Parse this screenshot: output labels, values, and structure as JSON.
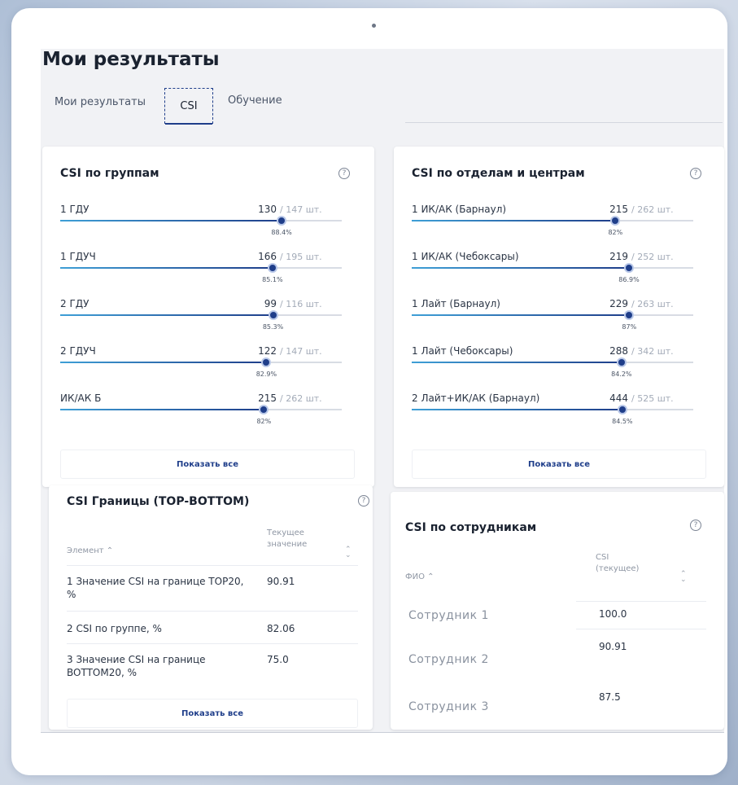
{
  "page": {
    "title": "Мои результаты"
  },
  "tabs": [
    {
      "label": "Мои результаты"
    },
    {
      "label": "CSI"
    },
    {
      "label": "Обучение"
    }
  ],
  "groups_card": {
    "title": "CSI по группам",
    "show_all": "Показать все",
    "items": [
      {
        "label": "1 ГДУ",
        "value": "130",
        "max": "/ 147 шт.",
        "percent_label": "88.4%",
        "percent": 88.4
      },
      {
        "label": "1 ГДУЧ",
        "value": "166",
        "max": "/ 195 шт.",
        "percent_label": "85.1%",
        "percent": 85.1
      },
      {
        "label": "2 ГДУ",
        "value": "99",
        "max": "/ 116 шт.",
        "percent_label": "85.3%",
        "percent": 85.3
      },
      {
        "label": "2 ГДУЧ",
        "value": "122",
        "max": "/ 147 шт.",
        "percent_label": "82.9%",
        "percent": 82.9
      },
      {
        "label": "ИК/АК Б",
        "value": "215",
        "max": "/ 262 шт.",
        "percent_label": "82%",
        "percent": 82
      }
    ]
  },
  "departments_card": {
    "title": "CSI по отделам и центрам",
    "show_all": "Показать все",
    "items": [
      {
        "label": "1 ИК/АК (Барнаул)",
        "value": "215",
        "max": "/ 262 шт.",
        "percent_label": "82%",
        "percent": 82
      },
      {
        "label": "1 ИК/АК (Чебоксары)",
        "value": "219",
        "max": "/ 252 шт.",
        "percent_label": "86.9%",
        "percent": 86.9
      },
      {
        "label": "1 Лайт (Барнаул)",
        "value": "229",
        "max": "/ 263 шт.",
        "percent_label": "87%",
        "percent": 87
      },
      {
        "label": "1 Лайт (Чебоксары)",
        "value": "288",
        "max": "/ 342 шт.",
        "percent_label": "84.2%",
        "percent": 84.2
      },
      {
        "label": "2 Лайт+ИК/АК (Барнаул)",
        "value": "444",
        "max": "/ 525 шт.",
        "percent_label": "84.5%",
        "percent": 84.5
      }
    ]
  },
  "bounds_card": {
    "title": "CSI Границы (TOP-BOTTOM)",
    "col_element": "Элемент",
    "col_current": "Текущее значение",
    "show_all": "Показать все",
    "rows": [
      {
        "element": "1 Значение CSI на границе TOP20, %",
        "value": "90.91"
      },
      {
        "element": "2 CSI по группе, %",
        "value": "82.06"
      },
      {
        "element": "3 Значение CSI на границе BOTTOM20, %",
        "value": "75.0"
      }
    ]
  },
  "employees_card": {
    "title": "CSI по сотрудникам",
    "col_name": "ФИО",
    "col_csi": "CSI (текущее)",
    "rows": [
      {
        "name": "Сотрудник 1",
        "value": "100.0"
      },
      {
        "name": "Сотрудник 2",
        "value": "90.91"
      },
      {
        "name": "Сотрудник 3",
        "value": "87.5"
      }
    ]
  },
  "colors": {
    "accent": "#1f3e8a",
    "bar_start": "#3e9fd6",
    "track": "#d8dce4"
  }
}
